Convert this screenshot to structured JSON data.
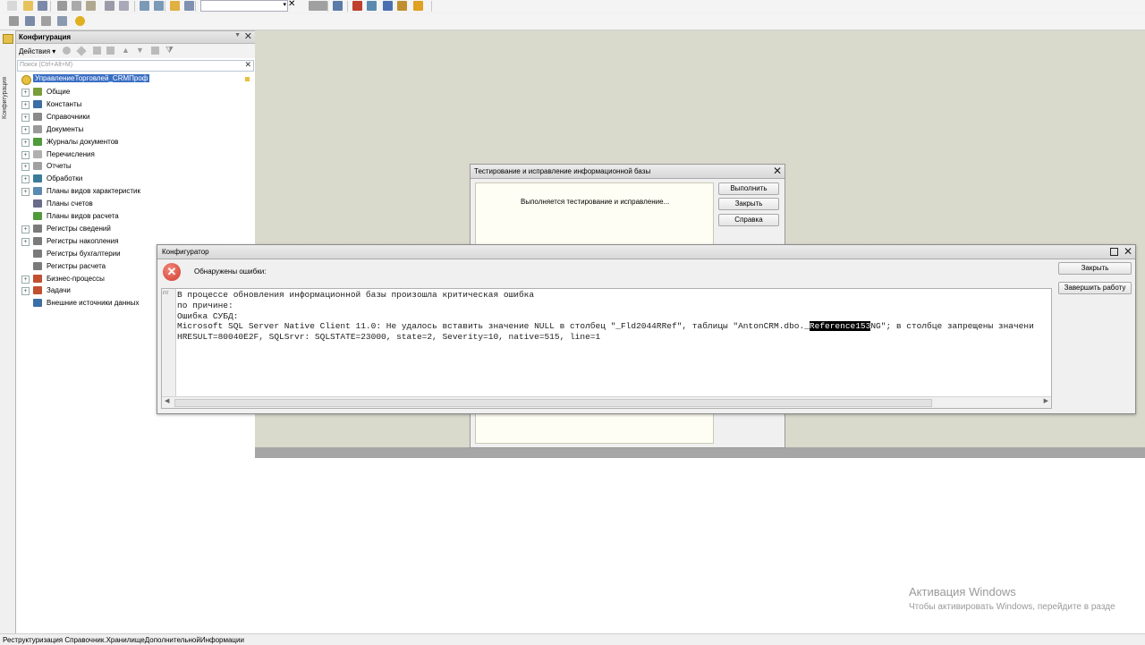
{
  "toolbar": {
    "search_value": "",
    "row1_icons": [
      "new-icon",
      "open-icon",
      "save-icon",
      "cut-icon",
      "copy-icon",
      "paste-icon",
      "print-icon",
      "print-preview-icon",
      "undo-icon",
      "redo-icon",
      "find-icon",
      "search-icon",
      "combo-dropdown-icon",
      "clear-search-icon",
      "find-next-icon",
      "find-prev-icon",
      "window-icon",
      "debug-icon",
      "syntax-check-icon",
      "help-book-icon",
      "info-icon"
    ],
    "row2_icons": [
      "grid-icon",
      "edit-icon",
      "module-icon",
      "form-icon",
      "run-icon"
    ]
  },
  "left_tab": {
    "label": "Конфигурация"
  },
  "config_panel": {
    "title": "Конфигурация",
    "actions_label": "Действия",
    "search_placeholder": "Поиск (Ctrl+Alt+M)",
    "root": "УправлениеТорговлей_CRMПроф",
    "items": [
      {
        "label": "Общие",
        "expandable": true,
        "icon_color": "#7a9c3a"
      },
      {
        "label": "Константы",
        "expandable": true,
        "icon_color": "#3a6ea5"
      },
      {
        "label": "Справочники",
        "expandable": true,
        "icon_color": "#8a8a8a"
      },
      {
        "label": "Документы",
        "expandable": true,
        "icon_color": "#9a9a9a"
      },
      {
        "label": "Журналы документов",
        "expandable": true,
        "icon_color": "#4f9a3a"
      },
      {
        "label": "Перечисления",
        "expandable": true,
        "icon_color": "#b0b0b0"
      },
      {
        "label": "Отчеты",
        "expandable": true,
        "icon_color": "#a0a0a0"
      },
      {
        "label": "Обработки",
        "expandable": true,
        "icon_color": "#3a7a9a"
      },
      {
        "label": "Планы видов характеристик",
        "expandable": true,
        "icon_color": "#5a8ab0"
      },
      {
        "label": "Планы счетов",
        "expandable": false,
        "icon_color": "#6a6a8a"
      },
      {
        "label": "Планы видов расчета",
        "expandable": false,
        "icon_color": "#4f9a3a"
      },
      {
        "label": "Регистры сведений",
        "expandable": true,
        "icon_color": "#7a7a7a"
      },
      {
        "label": "Регистры накопления",
        "expandable": true,
        "icon_color": "#7a7a7a"
      },
      {
        "label": "Регистры бухгалтерии",
        "expandable": false,
        "icon_color": "#7a7a7a"
      },
      {
        "label": "Регистры расчета",
        "expandable": false,
        "icon_color": "#7a7a7a"
      },
      {
        "label": "Бизнес-процессы",
        "expandable": true,
        "icon_color": "#c05030"
      },
      {
        "label": "Задачи",
        "expandable": true,
        "icon_color": "#c05030"
      },
      {
        "label": "Внешние источники данных",
        "expandable": false,
        "icon_color": "#3a6ea5"
      }
    ]
  },
  "test_dialog": {
    "title": "Тестирование и исправление информационной базы",
    "message": "Выполняется тестирование и исправление...",
    "buttons": [
      "Выполнить",
      "Закрыть",
      "Справка"
    ]
  },
  "error_dialog": {
    "title": "Конфигуратор",
    "header": "Обнаружены ошибки:",
    "gutter_label": "ггг",
    "lines": [
      "В процессе обновления информационной базы произошла критическая ошибка",
      "по причине:",
      "Ошибка СУБД:",
      "Microsoft SQL Server Native Client 11.0: Не удалось вставить значение NULL в столбец \"_Fld2044RRef\", таблицы \"AntonCRM.dbo._"
    ],
    "line4_highlight": "Reference153",
    "line4_rest": "NG\"; в столбце запрещены значени",
    "line5": "HRESULT=80040E2F, SQLSrvr: SQLSTATE=23000, state=2, Severity=10, native=515, line=1",
    "buttons": [
      "Закрыть",
      "Завершить работу"
    ]
  },
  "status_bar": {
    "text": "Реструктуризация Справочник.ХранилищеДополнительнойИнформации"
  },
  "watermark": {
    "line1": "Активация Windows",
    "line2": "Чтобы активировать Windows, перейдите в разде"
  }
}
